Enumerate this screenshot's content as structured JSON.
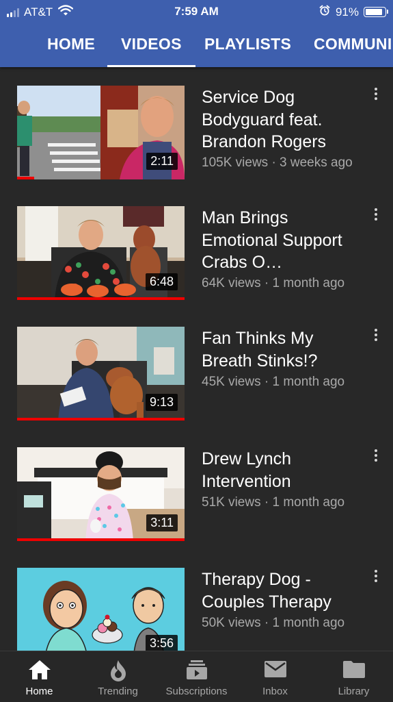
{
  "status_bar": {
    "carrier": "AT&T",
    "time": "7:59 AM",
    "battery": "91%",
    "battery_level": 0.91
  },
  "tabs": [
    "HOME",
    "VIDEOS",
    "PLAYLISTS",
    "COMMUNI"
  ],
  "active_tab": "VIDEOS",
  "videos": [
    {
      "title": "Service Dog Bodyguard feat. Brandon Rogers",
      "meta": "105K views · 3 weeks ago",
      "duration": "2:11",
      "watched": 0.1
    },
    {
      "title": "Man Brings Emotional Support Crabs O…",
      "meta": "64K views · 1 month ago",
      "duration": "6:48",
      "watched": 1.0
    },
    {
      "title": "Fan Thinks My Breath Stinks!?",
      "meta": "45K views · 1 month ago",
      "duration": "9:13",
      "watched": 1.0
    },
    {
      "title": "Drew Lynch Intervention",
      "meta": "51K views · 1 month ago",
      "duration": "3:11",
      "watched": 1.0
    },
    {
      "title": "Therapy Dog - Couples Therapy",
      "meta": "50K views · 1 month ago",
      "duration": "3:56",
      "watched": 0
    }
  ],
  "nav": [
    {
      "label": "Home",
      "icon": "home-icon",
      "active": true
    },
    {
      "label": "Trending",
      "icon": "flame-icon",
      "active": false
    },
    {
      "label": "Subscriptions",
      "icon": "subscriptions-icon",
      "active": false
    },
    {
      "label": "Inbox",
      "icon": "mail-icon",
      "active": false
    },
    {
      "label": "Library",
      "icon": "folder-icon",
      "active": false
    }
  ],
  "colors": {
    "header": "#3e5fae",
    "background": "#282828",
    "progress": "#ee0000",
    "nav_active": "#ffffff",
    "nav_inactive": "#a7a7a7"
  }
}
